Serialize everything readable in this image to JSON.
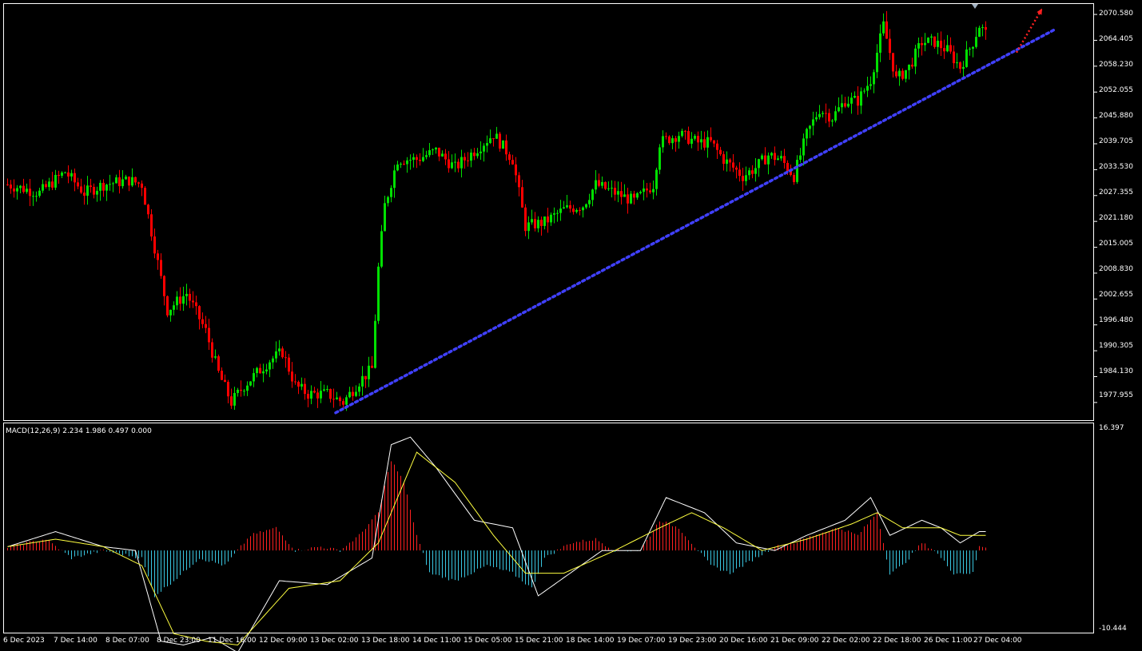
{
  "colors": {
    "background": "#000000",
    "frame": "#ffffff",
    "bull_candle": "#00e000",
    "bear_candle": "#ff0000",
    "trendline": "#4040ff",
    "forecast_arrow": "#ff2020",
    "histogram_positive": "#ff2020",
    "histogram_negative": "#39c6e0",
    "macd_line": "#ffffff",
    "signal_line": "#ffff40"
  },
  "price_axis": {
    "labels": [
      "2070.580",
      "2064.405",
      "2058.230",
      "2052.055",
      "2045.880",
      "2039.705",
      "2033.530",
      "2027.355",
      "2021.180",
      "2015.005",
      "2008.830",
      "2002.655",
      "1996.480",
      "1990.305",
      "1984.130",
      "1977.955"
    ]
  },
  "macd": {
    "title": "MACD(12,26,9) 2.234 1.986 0.497 0.000",
    "max_label": "16.397",
    "min_label": "-10.444"
  },
  "time_axis": {
    "labels": [
      "6 Dec 2023",
      "7 Dec 14:00",
      "8 Dec 07:00",
      "8 Dec 23:00",
      "11 Dec 16:00",
      "12 Dec 09:00",
      "13 Dec 02:00",
      "13 Dec 18:00",
      "14 Dec 11:00",
      "15 Dec 05:00",
      "15 Dec 21:00",
      "18 Dec 14:00",
      "19 Dec 07:00",
      "19 Dec 23:00",
      "20 Dec 16:00",
      "21 Dec 09:00",
      "22 Dec 02:00",
      "22 Dec 18:00",
      "26 Dec 11:00",
      "27 Dec 04:00"
    ]
  },
  "chart_data": {
    "type": "candlestick",
    "symbol_period": "H1",
    "price_range": [
      1974.5,
      2072.5
    ],
    "anchors": [
      [
        0,
        2030
      ],
      [
        10,
        2028
      ],
      [
        18,
        2033
      ],
      [
        24,
        2028
      ],
      [
        30,
        2030
      ],
      [
        38,
        2031
      ],
      [
        42,
        2030
      ],
      [
        46,
        2015
      ],
      [
        50,
        2000
      ],
      [
        56,
        2004
      ],
      [
        62,
        1995
      ],
      [
        66,
        1985
      ],
      [
        70,
        1978
      ],
      [
        74,
        1982
      ],
      [
        78,
        1985
      ],
      [
        82,
        1988
      ],
      [
        86,
        1990
      ],
      [
        90,
        1982
      ],
      [
        94,
        1980
      ],
      [
        100,
        1980
      ],
      [
        105,
        1978
      ],
      [
        110,
        1983
      ],
      [
        114,
        1986
      ],
      [
        116,
        2010
      ],
      [
        118,
        2025
      ],
      [
        122,
        2036
      ],
      [
        128,
        2036
      ],
      [
        134,
        2038
      ],
      [
        140,
        2034
      ],
      [
        146,
        2038
      ],
      [
        152,
        2042
      ],
      [
        158,
        2036
      ],
      [
        162,
        2020
      ],
      [
        168,
        2021
      ],
      [
        174,
        2024
      ],
      [
        180,
        2025
      ],
      [
        184,
        2030
      ],
      [
        190,
        2028
      ],
      [
        196,
        2026
      ],
      [
        202,
        2030
      ],
      [
        204,
        2040
      ],
      [
        210,
        2042
      ],
      [
        216,
        2040
      ],
      [
        220,
        2040
      ],
      [
        224,
        2036
      ],
      [
        230,
        2032
      ],
      [
        234,
        2034
      ],
      [
        238,
        2037
      ],
      [
        242,
        2036
      ],
      [
        246,
        2032
      ],
      [
        250,
        2042
      ],
      [
        254,
        2048
      ],
      [
        258,
        2046
      ],
      [
        262,
        2050
      ],
      [
        266,
        2050
      ],
      [
        270,
        2055
      ],
      [
        274,
        2068
      ],
      [
        278,
        2055
      ],
      [
        282,
        2058
      ],
      [
        286,
        2064
      ],
      [
        290,
        2064
      ],
      [
        294,
        2062
      ],
      [
        298,
        2058
      ],
      [
        302,
        2064
      ],
      [
        304,
        2068
      ],
      [
        306,
        2066
      ]
    ],
    "trendline": {
      "from": {
        "bar": 103,
        "price": 1975.5
      },
      "to": {
        "bar": 328,
        "price": 2067.0
      }
    },
    "forecast_arrow": {
      "from": {
        "bar": 316,
        "price": 2061.5
      },
      "to": {
        "bar": 324,
        "price": 2072.0
      }
    },
    "macd_series": {
      "macd": [
        [
          0,
          0.5
        ],
        [
          15,
          2.5
        ],
        [
          30,
          0.5
        ],
        [
          40,
          0
        ],
        [
          48,
          -12
        ],
        [
          55,
          -12.5
        ],
        [
          64,
          -11.5
        ],
        [
          72,
          -13.5
        ],
        [
          85,
          -4
        ],
        [
          100,
          -4.5
        ],
        [
          114,
          -1
        ],
        [
          120,
          14
        ],
        [
          126,
          15
        ],
        [
          134,
          11
        ],
        [
          146,
          4
        ],
        [
          158,
          3
        ],
        [
          166,
          -6
        ],
        [
          176,
          -3
        ],
        [
          186,
          0
        ],
        [
          198,
          0
        ],
        [
          206,
          7
        ],
        [
          218,
          5
        ],
        [
          228,
          1
        ],
        [
          240,
          0
        ],
        [
          250,
          2
        ],
        [
          262,
          4
        ],
        [
          270,
          7
        ],
        [
          276,
          2
        ],
        [
          286,
          4
        ],
        [
          292,
          3
        ],
        [
          298,
          1
        ],
        [
          304,
          2.5
        ]
      ],
      "signal": [
        [
          0,
          0.5
        ],
        [
          15,
          1.5
        ],
        [
          30,
          0.5
        ],
        [
          42,
          -2
        ],
        [
          52,
          -11
        ],
        [
          62,
          -12
        ],
        [
          72,
          -12.5
        ],
        [
          88,
          -5
        ],
        [
          104,
          -4
        ],
        [
          116,
          1
        ],
        [
          128,
          13
        ],
        [
          140,
          9
        ],
        [
          152,
          2
        ],
        [
          162,
          -3
        ],
        [
          174,
          -3
        ],
        [
          190,
          0
        ],
        [
          204,
          3
        ],
        [
          214,
          5
        ],
        [
          224,
          3
        ],
        [
          236,
          0
        ],
        [
          250,
          1.5
        ],
        [
          264,
          3.5
        ],
        [
          272,
          5
        ],
        [
          280,
          3
        ],
        [
          292,
          3
        ],
        [
          298,
          2
        ],
        [
          304,
          2
        ]
      ],
      "histogram": [
        [
          0,
          0.5
        ],
        [
          12,
          1.5
        ],
        [
          20,
          -1
        ],
        [
          30,
          0
        ],
        [
          42,
          -1
        ],
        [
          46,
          -6
        ],
        [
          52,
          -4
        ],
        [
          60,
          -1
        ],
        [
          68,
          -2
        ],
        [
          76,
          2
        ],
        [
          84,
          3
        ],
        [
          90,
          0
        ],
        [
          98,
          0.5
        ],
        [
          104,
          0
        ],
        [
          110,
          2
        ],
        [
          116,
          5
        ],
        [
          120,
          12
        ],
        [
          124,
          9
        ],
        [
          128,
          2
        ],
        [
          132,
          -3
        ],
        [
          140,
          -4
        ],
        [
          150,
          -2
        ],
        [
          158,
          -3
        ],
        [
          164,
          -5
        ],
        [
          168,
          -1
        ],
        [
          176,
          1
        ],
        [
          184,
          1.5
        ],
        [
          190,
          0
        ],
        [
          198,
          0
        ],
        [
          204,
          4
        ],
        [
          210,
          3
        ],
        [
          214,
          1
        ],
        [
          220,
          -2
        ],
        [
          226,
          -3
        ],
        [
          234,
          -1
        ],
        [
          240,
          0.5
        ],
        [
          246,
          1
        ],
        [
          252,
          2
        ],
        [
          260,
          3
        ],
        [
          266,
          2
        ],
        [
          272,
          5
        ],
        [
          276,
          -3
        ],
        [
          280,
          -2
        ],
        [
          286,
          1
        ],
        [
          290,
          0
        ],
        [
          296,
          -3
        ],
        [
          302,
          -3
        ],
        [
          304,
          0.5
        ],
        [
          306,
          0.5
        ]
      ],
      "range": [
        -10.444,
        16.397
      ]
    }
  }
}
